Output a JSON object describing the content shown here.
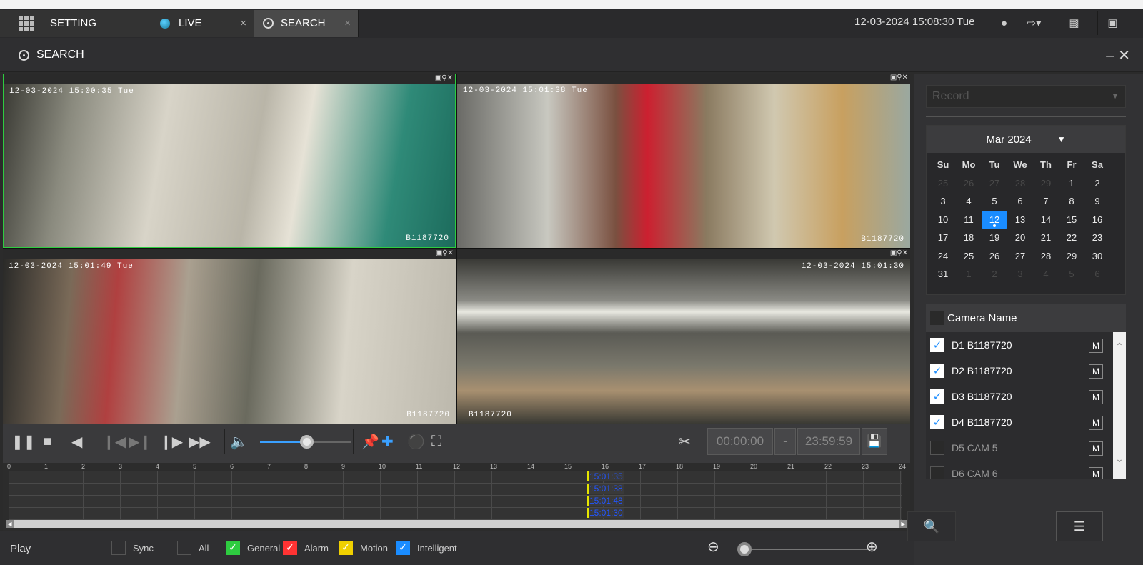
{
  "topbar": {
    "tabs": [
      {
        "label": "SETTING"
      },
      {
        "label": "LIVE",
        "close": "×"
      },
      {
        "label": "SEARCH",
        "close": "×"
      }
    ],
    "datetime": "12-03-2024 15:08:30 Tue"
  },
  "window": {
    "title": "SEARCH",
    "minimize": "–",
    "close": "✕"
  },
  "video": {
    "cells": [
      {
        "timestamp": "12-03-2024 15:00:35 Tue",
        "camera_id": "B1187720"
      },
      {
        "timestamp": "12-03-2024 15:01:38 Tue",
        "camera_id": "B1187720"
      },
      {
        "timestamp": "12-03-2024 15:01:49 Tue",
        "camera_id": "B1187720"
      },
      {
        "timestamp": "12-03-2024 15:01:30",
        "camera_id": "B1187720"
      }
    ]
  },
  "playback": {
    "volume": 0.55,
    "clip_start": "00:00:00",
    "clip_sep": "-",
    "clip_end": "23:59:59"
  },
  "timeline": {
    "hours": [
      "0",
      "1",
      "2",
      "3",
      "4",
      "5",
      "6",
      "7",
      "8",
      "9",
      "10",
      "11",
      "12",
      "13",
      "14",
      "15",
      "16",
      "17",
      "18",
      "19",
      "20",
      "21",
      "22",
      "23",
      "24"
    ],
    "records": [
      "15:01:35",
      "15:01:38",
      "15:01:48",
      "15:01:30"
    ]
  },
  "footer": {
    "play_label": "Play",
    "filters": [
      {
        "label": "Sync",
        "checked": false,
        "color": "#2f2f31"
      },
      {
        "label": "All",
        "checked": false,
        "color": "#2f2f31"
      },
      {
        "label": "General",
        "checked": true,
        "color": "#2ecc40"
      },
      {
        "label": "Alarm",
        "checked": true,
        "color": "#ff3333"
      },
      {
        "label": "Motion",
        "checked": true,
        "color": "#f0d000"
      },
      {
        "label": "Intelligent",
        "checked": true,
        "color": "#1a8cff"
      }
    ],
    "zoom_level": 0
  },
  "sidebar": {
    "record_type": "Record",
    "calendar": {
      "month": "Mar 2024",
      "weekdays": [
        "Su",
        "Mo",
        "Tu",
        "We",
        "Th",
        "Fr",
        "Sa"
      ],
      "days": [
        "25",
        "26",
        "27",
        "28",
        "29",
        "1",
        "2",
        "3",
        "4",
        "5",
        "6",
        "7",
        "8",
        "9",
        "10",
        "11",
        "12",
        "13",
        "14",
        "15",
        "16",
        "17",
        "18",
        "19",
        "20",
        "21",
        "22",
        "23",
        "24",
        "25",
        "26",
        "27",
        "28",
        "29",
        "30",
        "31",
        "1",
        "2",
        "3",
        "4",
        "5",
        "6"
      ],
      "selected": "12"
    },
    "camera_header": "Camera Name",
    "cameras": [
      {
        "name": "D1 B1187720",
        "checked": true
      },
      {
        "name": "D2 B1187720",
        "checked": true
      },
      {
        "name": "D3 B1187720",
        "checked": true
      },
      {
        "name": "D4 B1187720",
        "checked": true
      },
      {
        "name": "D5 CAM 5",
        "checked": false
      },
      {
        "name": "D6 CAM 6",
        "checked": false
      }
    ],
    "m_label": "M"
  },
  "colors": {
    "accent": "#1a8cff",
    "active_cell_border": "#2ecc40"
  }
}
